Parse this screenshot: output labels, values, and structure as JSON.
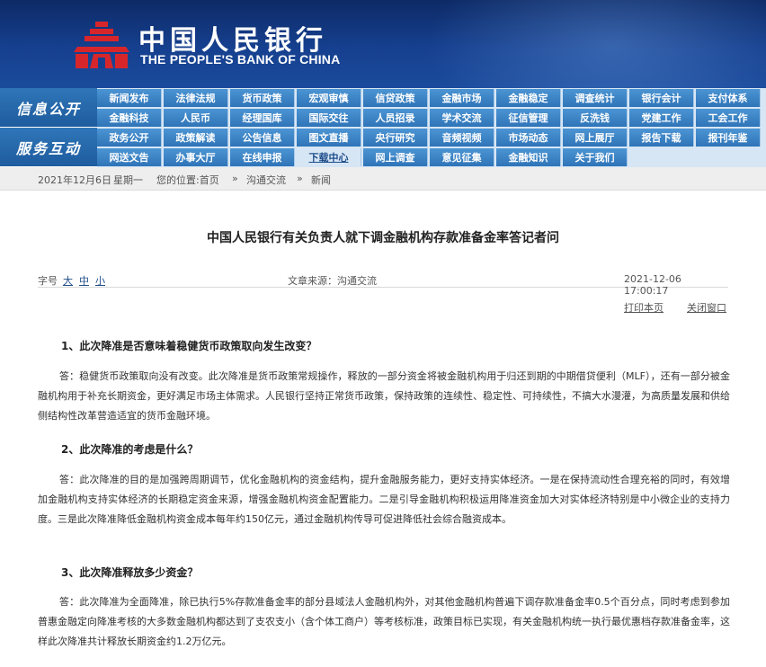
{
  "header": {
    "logo_cn": "中国人民银行",
    "logo_en": "THE PEOPLE'S BANK OF CHINA"
  },
  "nav": {
    "groups": [
      {
        "label": "信息公开",
        "rows": [
          [
            "新闻发布",
            "法律法规",
            "货币政策",
            "宏观审慎",
            "信贷政策",
            "金融市场",
            "金融稳定",
            "调查统计",
            "银行会计",
            "支付体系"
          ],
          [
            "金融科技",
            "人民币",
            "经理国库",
            "国际交往",
            "人员招录",
            "学术交流",
            "征信管理",
            "反洗钱",
            "党建工作",
            "工会工作"
          ]
        ]
      },
      {
        "label": "服务互动",
        "rows": [
          [
            "政务公开",
            "政策解读",
            "公告信息",
            "图文直播",
            "央行研究",
            "音频视频",
            "市场动态",
            "网上展厅",
            "报告下载",
            "报刊年鉴"
          ],
          [
            "网送文告",
            "办事大厅",
            "在线申报",
            "下载中心",
            "网上调查",
            "意见征集",
            "金融知识",
            "关于我们"
          ]
        ]
      }
    ]
  },
  "breadcrumb": {
    "date": "2021年12月6日",
    "weekday": "星期一",
    "location_label": "您的位置:首页",
    "sep1": "»",
    "section": "沟通交流",
    "sep2": "»",
    "page": "新闻"
  },
  "article": {
    "title": "中国人民银行有关负责人就下调金融机构存款准备金率答记者问",
    "font_label": "字号",
    "font_large": "大",
    "font_medium": "中",
    "font_small": "小",
    "source": "文章来源：沟通交流",
    "datetime": "2021-12-06  17:00:17",
    "print_label": "打印本页",
    "close_label": "关闭窗口",
    "sections": [
      {
        "question": "1、此次降准是否意味着稳健货币政策取向发生改变？",
        "answer": "答：稳健货币政策取向没有改变。此次降准是货币政策常规操作，释放的一部分资金将被金融机构用于归还到期的中期借贷便利（MLF），还有一部分被金融机构用于补充长期资金，更好满足市场主体需求。人民银行坚持正常货币政策，保持政策的连续性、稳定性、可持续性，不搞大水漫灌，为高质量发展和供给侧结构性改革营造适宜的货币金融环境。"
      },
      {
        "question": "2、此次降准的考虑是什么？",
        "answer": "答：此次降准的目的是加强跨周期调节，优化金融机构的资金结构，提升金融服务能力，更好支持实体经济。一是在保持流动性合理充裕的同时，有效增加金融机构支持实体经济的长期稳定资金来源，增强金融机构资金配置能力。二是引导金融机构积极运用降准资金加大对实体经济特别是中小微企业的支持力度。三是此次降准降低金融机构资金成本每年约150亿元，通过金融机构传导可促进降低社会综合融资成本。"
      },
      {
        "question": "3、此次降准释放多少资金？",
        "answer": "答：此次降准为全面降准，除已执行5%存款准备金率的部分县域法人金融机构外，对其他金融机构普遍下调存款准备金率0.5个百分点，同时考虑到参加普惠金融定向降准考核的大多数金融机构都达到了支农支小（含个体工商户）等考核标准，政策目标已实现，有关金融机构统一执行最优惠档存款准备金率，这样此次降准共计释放长期资金约1.2万亿元。"
      }
    ]
  },
  "colors": {
    "header_bg": "#16408f",
    "nav_bg": "#d7e6f5",
    "nav_item": "#2f74b8",
    "emblem_red": "#d7262b"
  }
}
